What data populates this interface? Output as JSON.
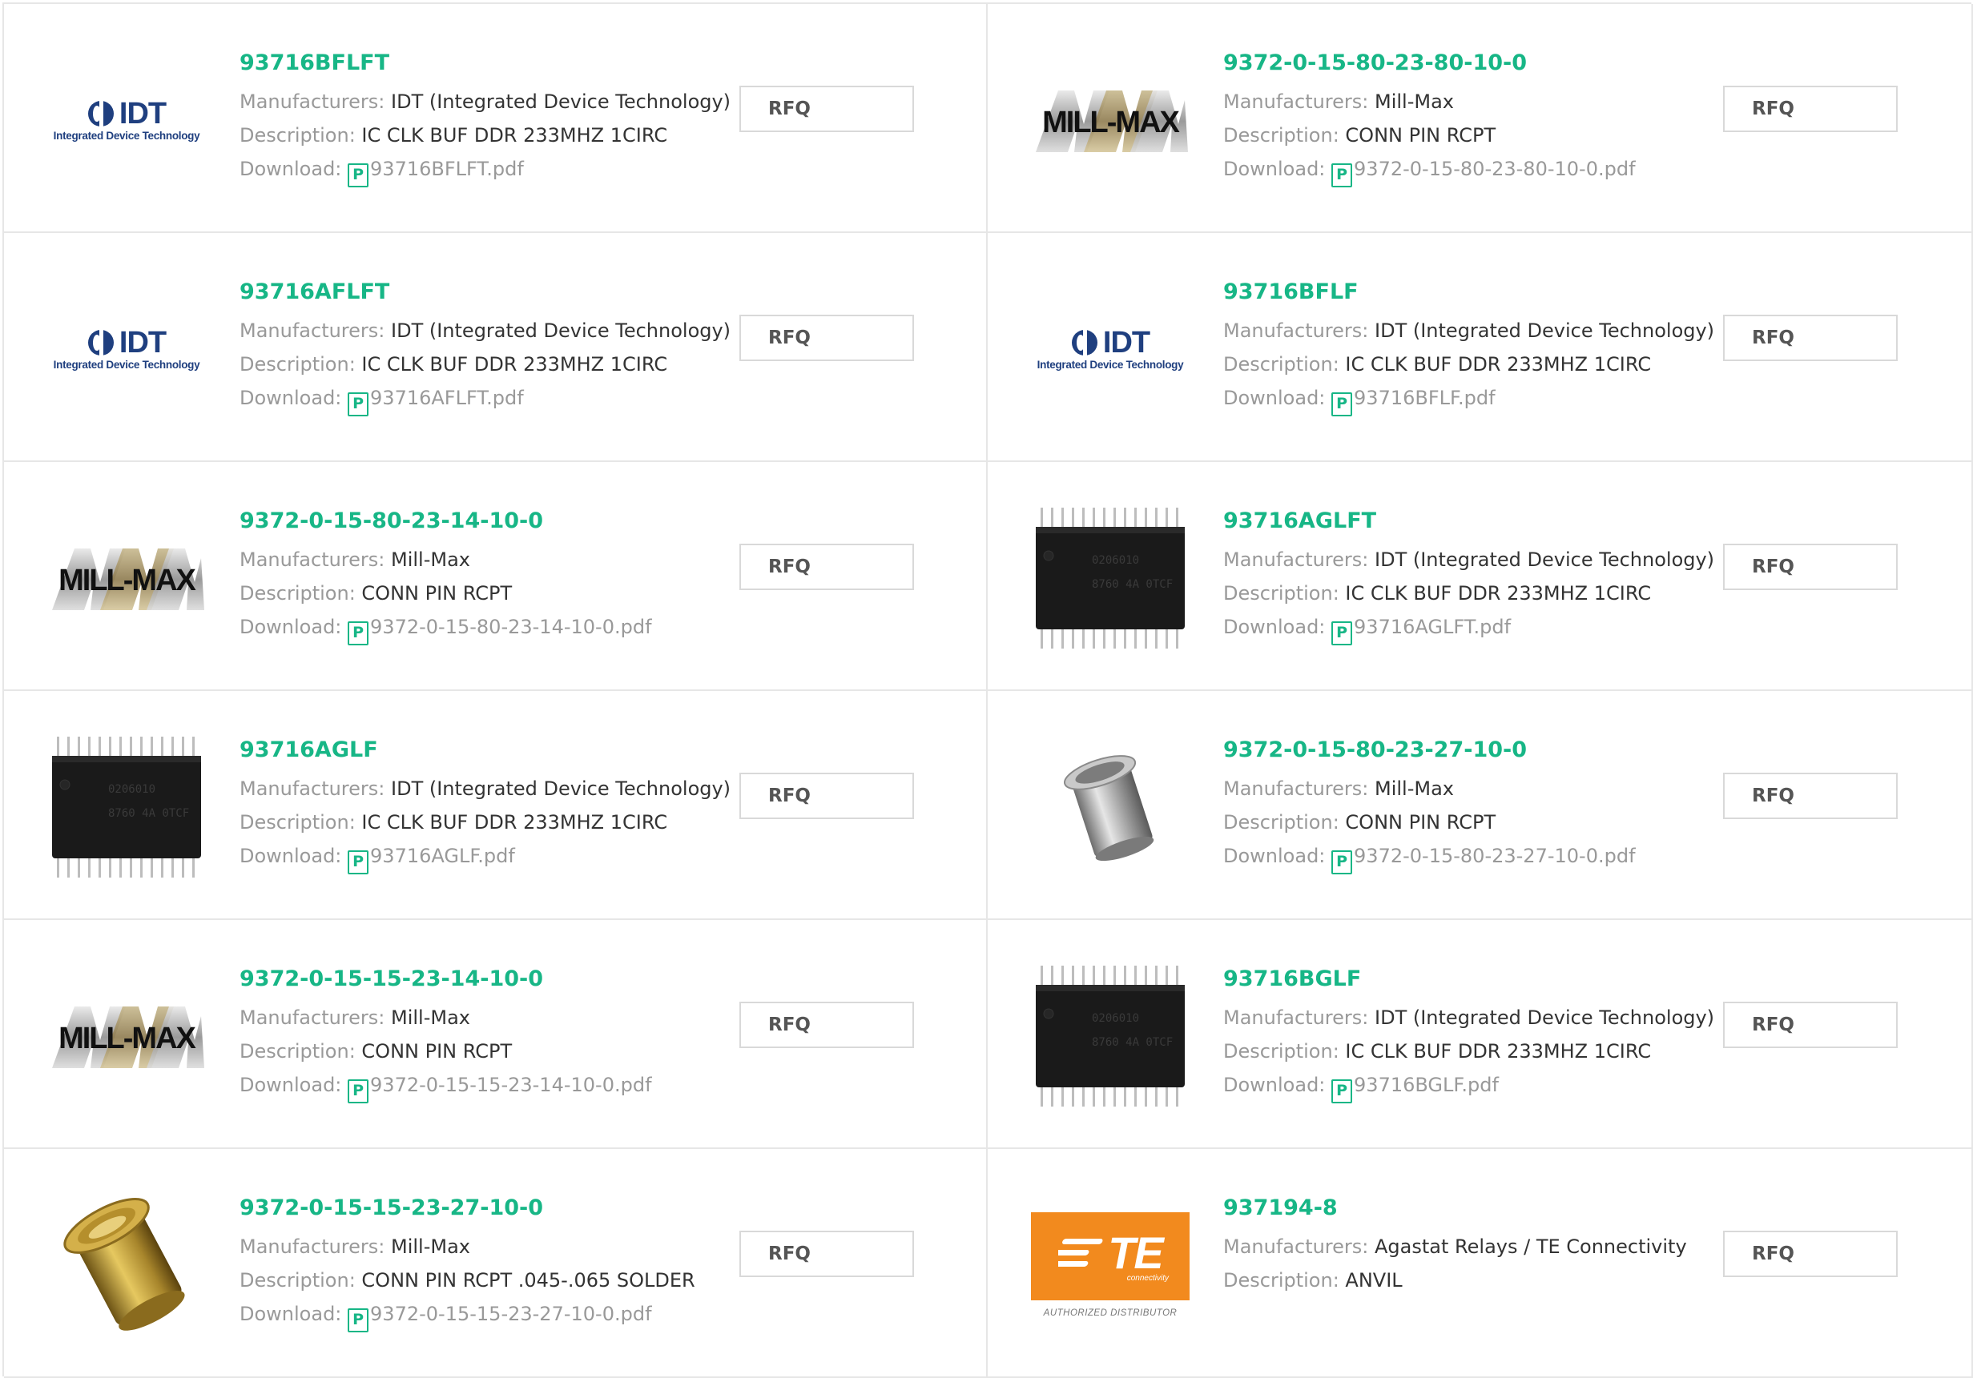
{
  "labels": {
    "manufacturers": "Manufacturers:",
    "description": "Description:",
    "download": "Download:",
    "rfq": "RFQ",
    "pdf_icon": "P"
  },
  "logos": {
    "idt": {
      "mark": "IDT",
      "sub": "Integrated Device Technology"
    },
    "te": {
      "mark": "TE",
      "sub": "connectivity",
      "caption": "AUTHORIZED DISTRIBUTOR"
    },
    "millmax": {
      "mark": "MILL-MAX"
    }
  },
  "colors": {
    "accent_green": "#17b686",
    "border": "#e6e6e6",
    "label_gray": "#999999",
    "te_orange": "#f28a1e"
  },
  "products": [
    {
      "name": "93716BFLFT",
      "manufacturer": "IDT (Integrated Device Technology)",
      "description": "IC CLK BUF DDR 233MHZ 1CIRC",
      "pdf": "93716BFLFT.pdf",
      "image": "idt-logo"
    },
    {
      "name": "9372-0-15-80-23-80-10-0",
      "manufacturer": "Mill-Max",
      "description": "CONN PIN RCPT",
      "pdf": "9372-0-15-80-23-80-10-0.pdf",
      "image": "millmax-logo"
    },
    {
      "name": "93716AFLFT",
      "manufacturer": "IDT (Integrated Device Technology)",
      "description": "IC CLK BUF DDR 233MHZ 1CIRC",
      "pdf": "93716AFLFT.pdf",
      "image": "idt-logo"
    },
    {
      "name": "93716BFLF",
      "manufacturer": "IDT (Integrated Device Technology)",
      "description": "IC CLK BUF DDR 233MHZ 1CIRC",
      "pdf": "93716BFLF.pdf",
      "image": "idt-logo"
    },
    {
      "name": "9372-0-15-80-23-14-10-0",
      "manufacturer": "Mill-Max",
      "description": "CONN PIN RCPT",
      "pdf": "9372-0-15-80-23-14-10-0.pdf",
      "image": "millmax-logo"
    },
    {
      "name": "93716AGLFT",
      "manufacturer": "IDT (Integrated Device Technology)",
      "description": "IC CLK BUF DDR 233MHZ 1CIRC",
      "pdf": "93716AGLFT.pdf",
      "image": "ic-chip-photo"
    },
    {
      "name": "93716AGLF",
      "manufacturer": "IDT (Integrated Device Technology)",
      "description": "IC CLK BUF DDR 233MHZ 1CIRC",
      "pdf": "93716AGLF.pdf",
      "image": "ic-chip-photo"
    },
    {
      "name": "9372-0-15-80-23-27-10-0",
      "manufacturer": "Mill-Max",
      "description": "CONN PIN RCPT",
      "pdf": "9372-0-15-80-23-27-10-0.pdf",
      "image": "silver-pin-photo"
    },
    {
      "name": "9372-0-15-15-23-14-10-0",
      "manufacturer": "Mill-Max",
      "description": "CONN PIN RCPT",
      "pdf": "9372-0-15-15-23-14-10-0.pdf",
      "image": "millmax-logo"
    },
    {
      "name": "93716BGLF",
      "manufacturer": "IDT (Integrated Device Technology)",
      "description": "IC CLK BUF DDR 233MHZ 1CIRC",
      "pdf": "93716BGLF.pdf",
      "image": "ic-chip-photo"
    },
    {
      "name": "9372-0-15-15-23-27-10-0",
      "manufacturer": "Mill-Max",
      "description": "CONN PIN RCPT .045-.065 SOLDER",
      "pdf": "9372-0-15-15-23-27-10-0.pdf",
      "image": "gold-pin-photo"
    },
    {
      "name": "937194-8",
      "manufacturer": "Agastat Relays / TE Connectivity",
      "description": "ANVIL",
      "pdf": null,
      "image": "te-connectivity-logo"
    }
  ]
}
